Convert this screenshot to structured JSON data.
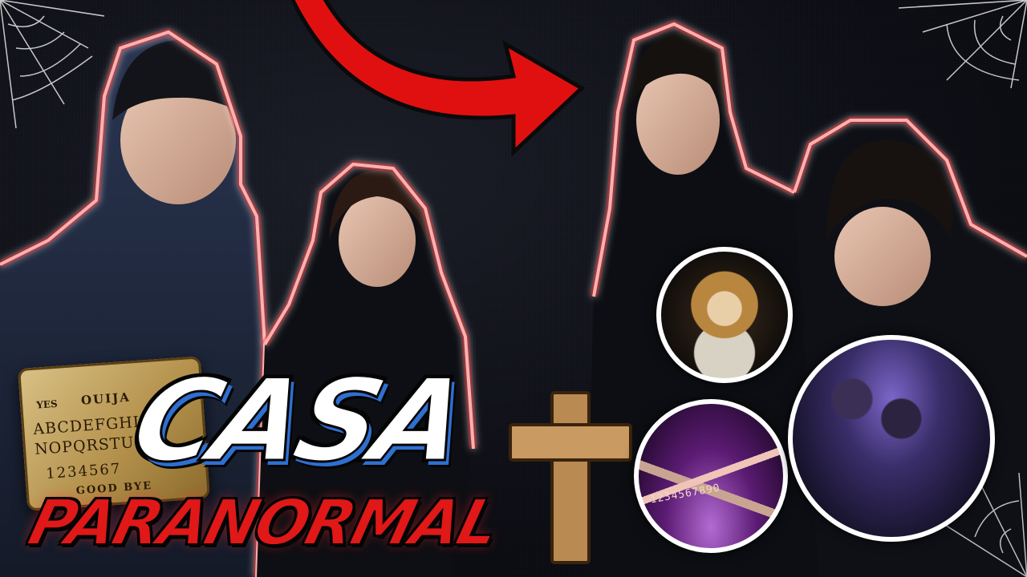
{
  "thumbnail": {
    "title_line1": "CASA",
    "title_line2": "PARANORMAL"
  },
  "ouija_board": {
    "yes": "YES",
    "title": "OUIJA",
    "row1": "ABCDEFGHIJK",
    "row2": "NOPQRSTU",
    "digits": "1234567",
    "bye": "GOOD BYE"
  },
  "board_circle": {
    "label": "1234567890"
  },
  "colors": {
    "accent_red": "#e01818",
    "accent_blue": "#2f6fd0",
    "outline_white": "#ffffff",
    "cross_wood": "#b98a52"
  },
  "icons": {
    "arrow": "red-curved-arrow",
    "cross": "wooden-cross",
    "cobwebs": "cobweb"
  }
}
